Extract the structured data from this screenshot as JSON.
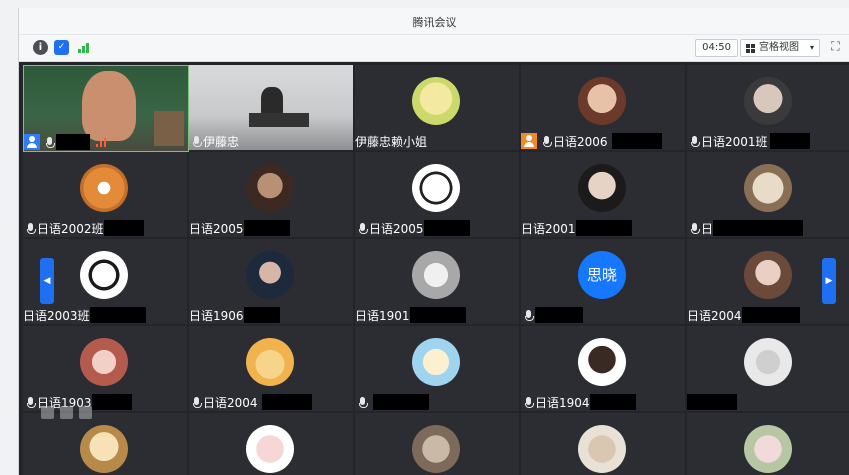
{
  "window": {
    "title": "腾讯会议"
  },
  "toolbar": {
    "timer": "04:50",
    "view_label": "宫格视图",
    "icons": [
      "info-icon",
      "shield-icon",
      "signal-icon",
      "grid-icon",
      "chevron-down-icon",
      "fullscreen-icon"
    ]
  },
  "colors": {
    "accent": "#1e6ff1",
    "tile_bg": "#2b2d33",
    "host_blue": "#2d7df6",
    "host_orange": "#f08a24",
    "avatar_blue": "#1677ff"
  },
  "participants": [
    {
      "name": "",
      "kind": "camera"
    },
    {
      "name": "伊藤忠",
      "kind": "camera"
    },
    {
      "name": "伊藤忠赖小姐"
    },
    {
      "name": "日语2006"
    },
    {
      "name": "日语2001班"
    },
    {
      "name": "日语2002班"
    },
    {
      "name": "日语2005"
    },
    {
      "name": "日语2005"
    },
    {
      "name": "日语2001"
    },
    {
      "name": "日"
    },
    {
      "name": "日语2003班"
    },
    {
      "name": "日语1906"
    },
    {
      "name": "日语1901"
    },
    {
      "name": "",
      "avatar_text": "思晓"
    },
    {
      "name": "日语2004"
    },
    {
      "name": "日语1903"
    },
    {
      "name": "日语2004"
    },
    {
      "name": ""
    },
    {
      "name": "日语1904"
    },
    {
      "name": ""
    }
  ]
}
